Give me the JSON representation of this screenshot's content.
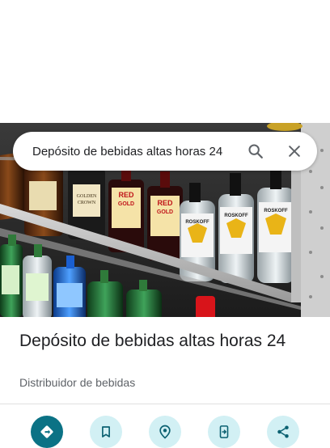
{
  "search": {
    "query": "Depósito de bebidas altas horas 24",
    "search_icon": "search-icon",
    "close_icon": "close-icon"
  },
  "photo": {
    "brand_labels": [
      "GOLDEN CROWN",
      "RED GOLD",
      "RED GOLD",
      "ROSKOFF",
      "ROSKOFF",
      "ROSKOFF"
    ]
  },
  "place": {
    "title": "Depósito de bebidas altas horas 24",
    "category": "Distribuidor de bebidas"
  },
  "actions": [
    {
      "name": "directions",
      "icon": "directions-icon"
    },
    {
      "name": "save",
      "icon": "bookmark-icon"
    },
    {
      "name": "nearby",
      "icon": "nearby-icon"
    },
    {
      "name": "send-to-phone",
      "icon": "phone-icon"
    },
    {
      "name": "share",
      "icon": "share-icon"
    }
  ],
  "colors": {
    "accent": "#0b7285",
    "action_bg": "#d2f0f4",
    "action_icon": "#0b6171"
  }
}
